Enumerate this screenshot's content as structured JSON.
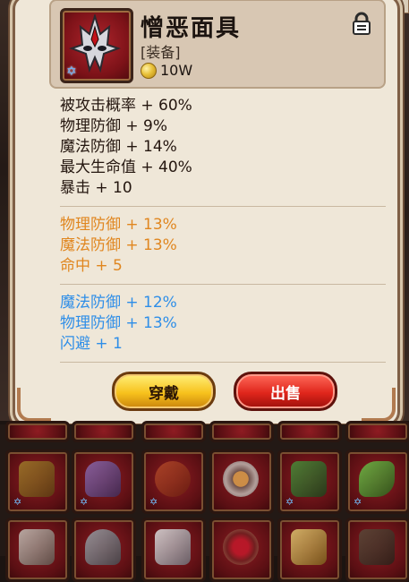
{
  "item": {
    "name": "憎恶面具",
    "type": "[装备]",
    "price": "10W",
    "icon": "mask-icon",
    "locked": true
  },
  "stats": {
    "base": [
      "被攻击概率 + 60%",
      "物理防御 + 9%",
      "魔法防御 + 14%",
      "最大生命值 + 40%",
      "暴击 + 10"
    ],
    "orange": [
      "物理防御 + 13%",
      "魔法防御 + 13%",
      "命中 + 5"
    ],
    "blue": [
      "魔法防御 + 12%",
      "物理防御 + 13%",
      "闪避 + 1"
    ]
  },
  "buttons": {
    "equip": "穿戴",
    "sell": "出售"
  },
  "colors": {
    "orange": "#e0861f",
    "blue": "#2e8ee8",
    "equip_button": "#f7c21d",
    "sell_button": "#e0261c"
  },
  "inventory": {
    "row1_icons": [
      "gloves-icon",
      "wizard-hat-icon",
      "belt-icon",
      "ring-icon",
      "armor-icon",
      "bow-icon"
    ],
    "row2_icons": [
      "shield-icon",
      "helmet-icon",
      "amulet-icon",
      "ring-icon",
      "sword-icon",
      "boots-icon"
    ]
  }
}
